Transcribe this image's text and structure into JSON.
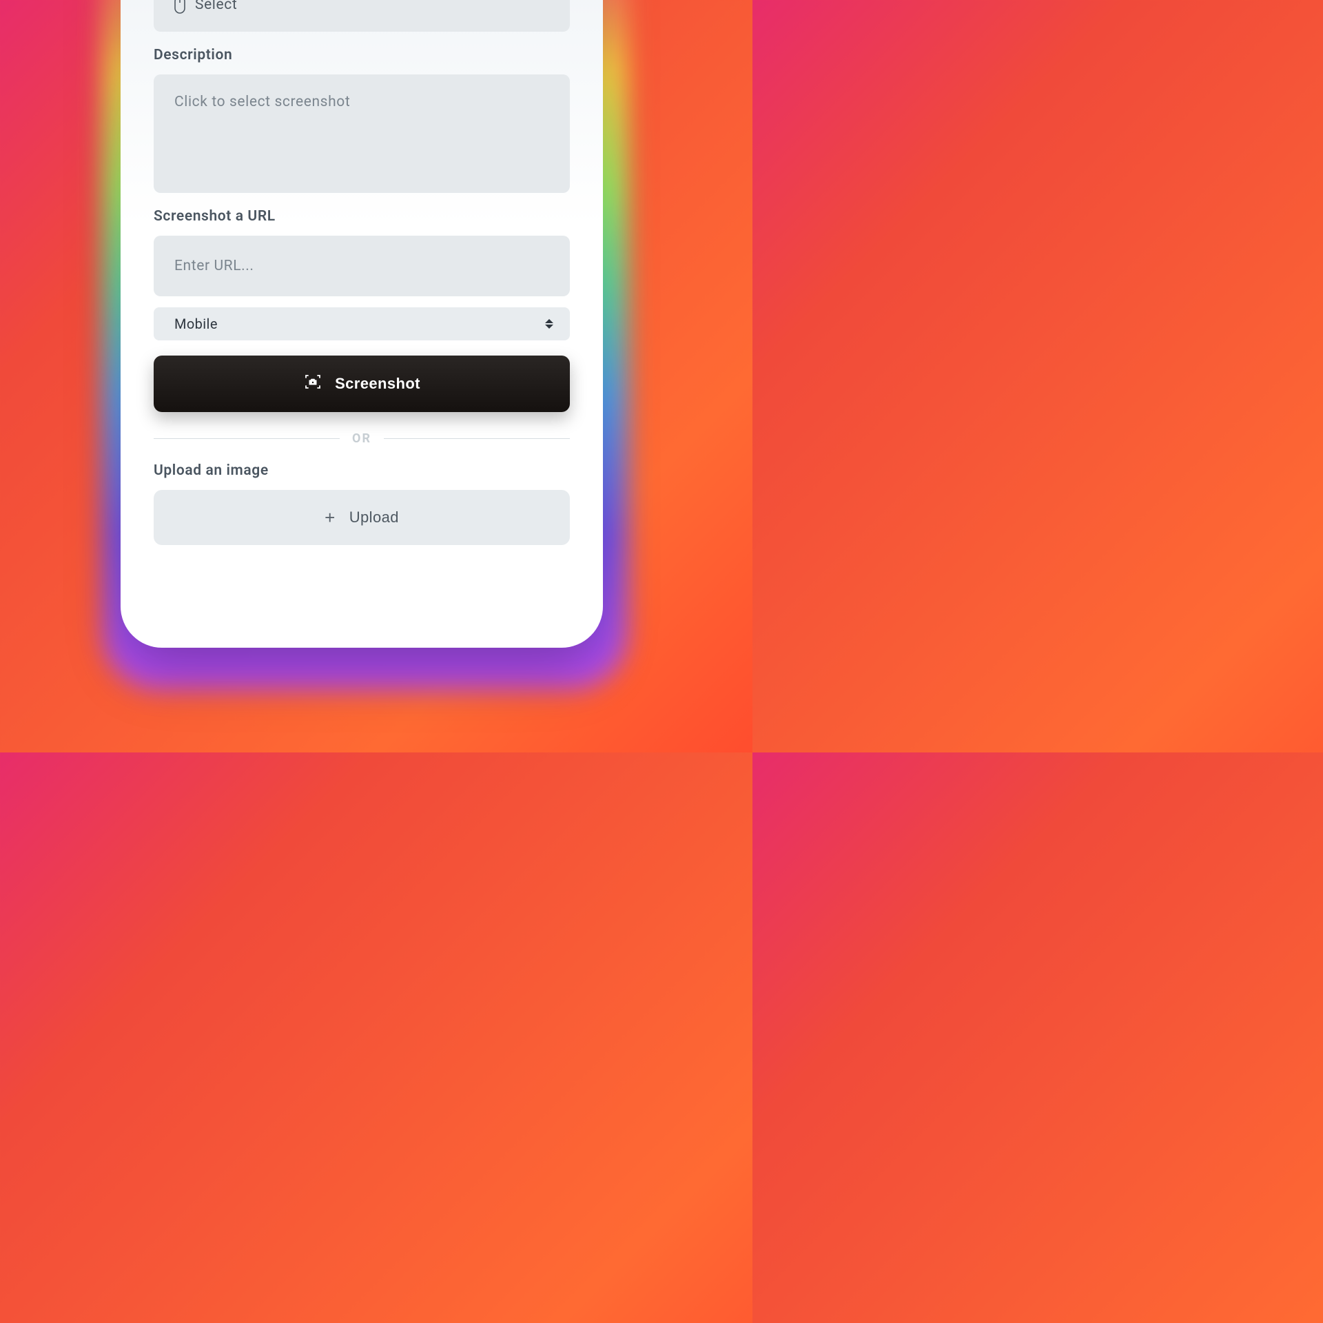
{
  "select_field": {
    "label": "Select"
  },
  "description": {
    "label": "Description",
    "placeholder": "Click to select screenshot"
  },
  "screenshot_url": {
    "label": "Screenshot a URL",
    "placeholder": "Enter URL...",
    "device_select": {
      "value": "Mobile"
    },
    "button": "Screenshot"
  },
  "divider": "OR",
  "upload": {
    "label": "Upload an image",
    "button": "Upload"
  }
}
